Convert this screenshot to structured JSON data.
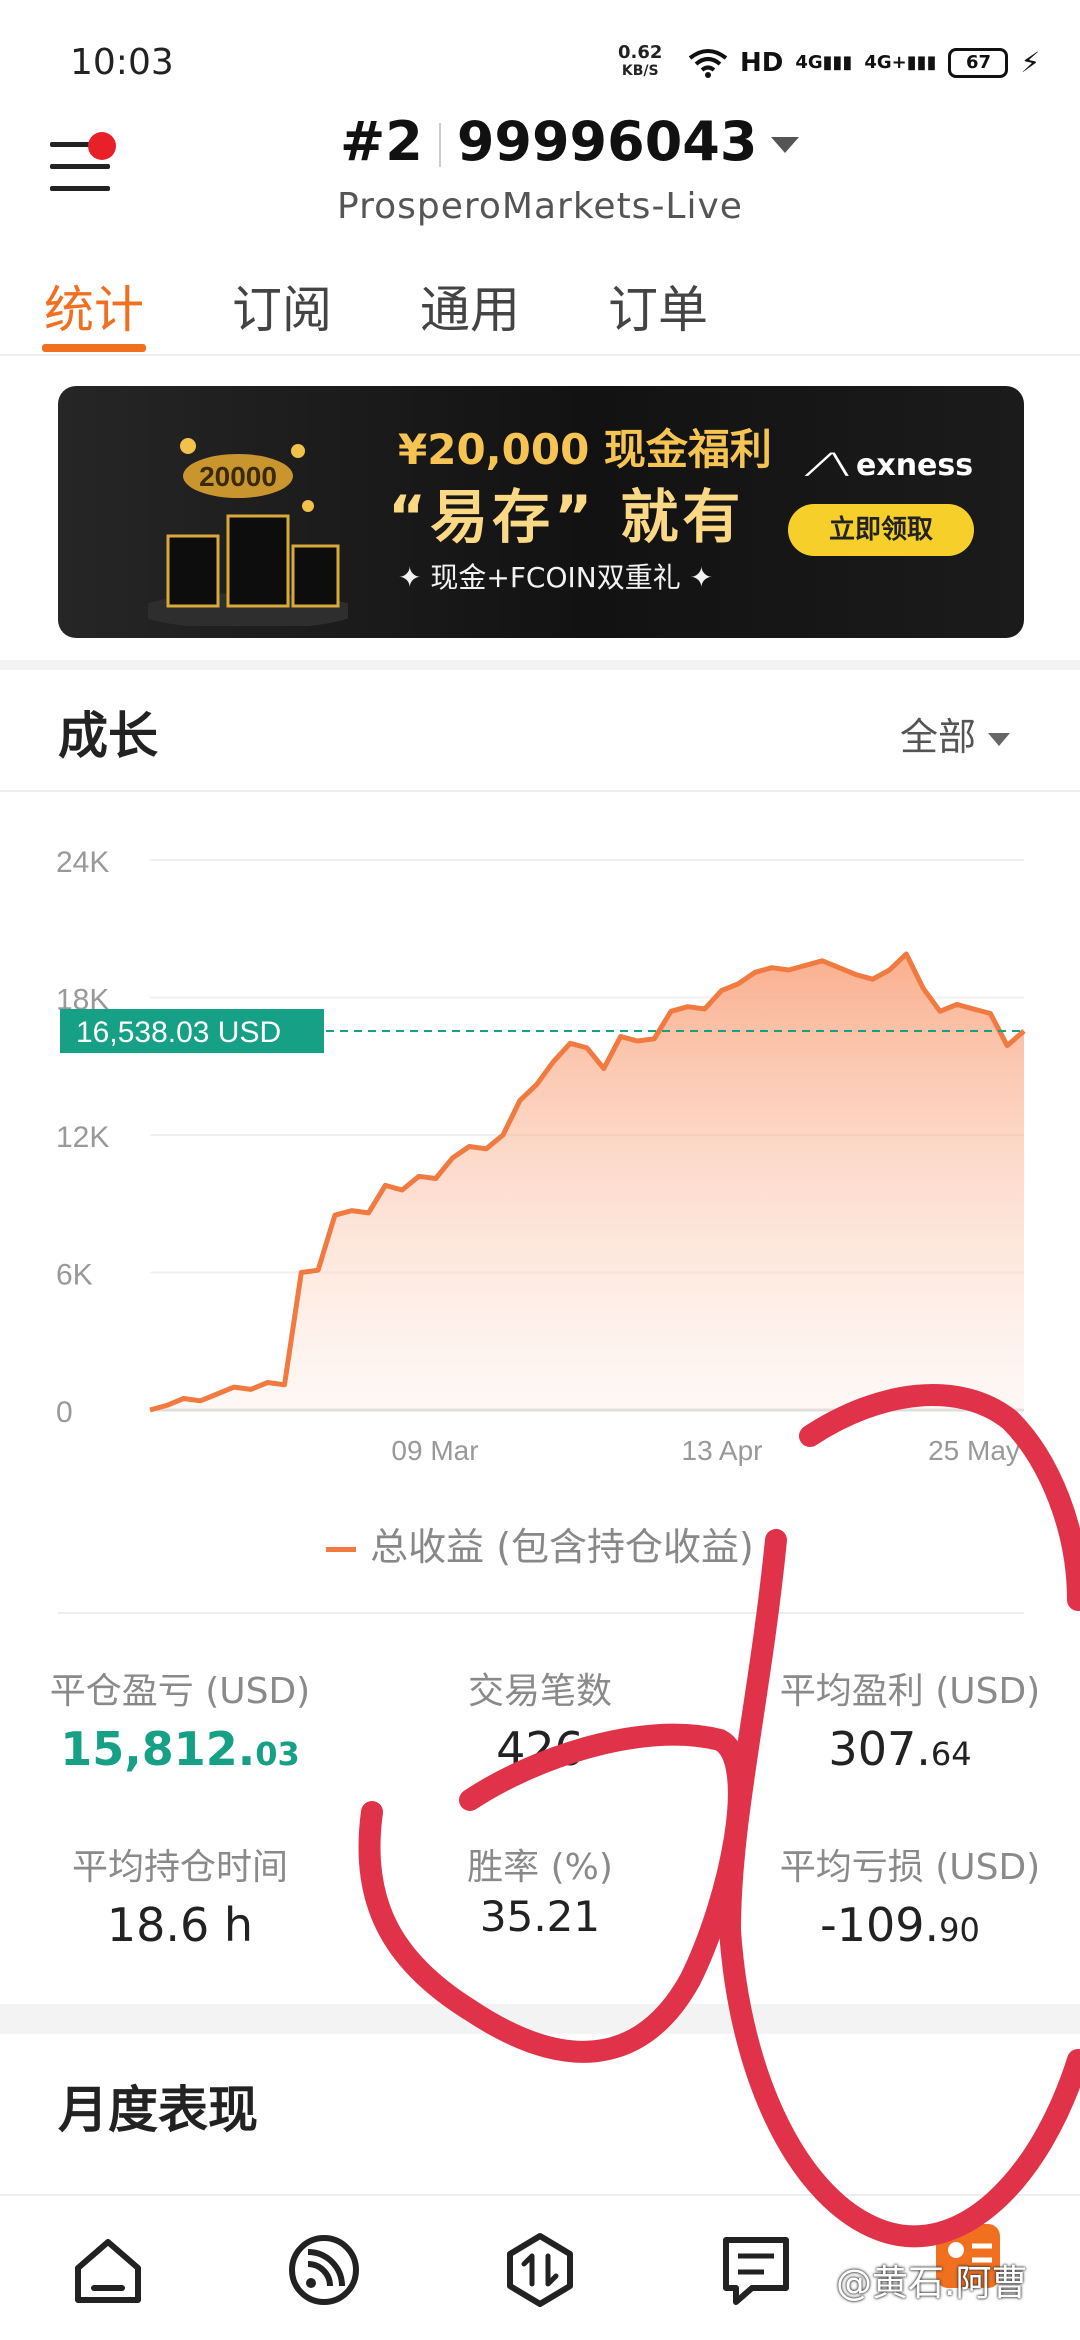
{
  "status_bar": {
    "time": "10:03",
    "net_speed": "0.62",
    "net_unit": "KB/S",
    "hd_label": "HD",
    "signal_1": "4G",
    "signal_2": "4G+",
    "battery": "67"
  },
  "header": {
    "account_number_prefix": "#2",
    "account_number": "99996043",
    "server": "ProsperoMarkets-Live"
  },
  "tabs": [
    {
      "label": "统计",
      "active": true
    },
    {
      "label": "订阅",
      "active": false
    },
    {
      "label": "通用",
      "active": false
    },
    {
      "label": "订单",
      "active": false
    }
  ],
  "banner": {
    "line1": "¥20,000 现金福利",
    "line2": "“易存” 就有",
    "line3": "✦  现金+FCOIN双重礼  ✦",
    "brand": "exness",
    "cta": "立即领取",
    "gift_label": "20000"
  },
  "growth": {
    "title": "成长",
    "filter": "全部",
    "legend": "总收益 (包含持仓收益)"
  },
  "chart_data": {
    "type": "area",
    "series": [
      {
        "name": "总收益 (包含持仓收益)",
        "color": "#f07a40"
      }
    ],
    "x_ticks": [
      "09 Mar",
      "13 Apr",
      "25 May"
    ],
    "y_ticks": [
      "0",
      "6K",
      "12K",
      "18K",
      "24K"
    ],
    "ylim": [
      0,
      24000
    ],
    "current_value_label": "16,538.03 USD",
    "current_value": 16538.03,
    "values": [
      0,
      200,
      500,
      400,
      700,
      1000,
      900,
      1200,
      1100,
      6000,
      6100,
      8500,
      8700,
      8600,
      9800,
      9600,
      10200,
      10100,
      11000,
      11500,
      11400,
      12000,
      13500,
      14200,
      15200,
      16000,
      15800,
      14900,
      16300,
      16100,
      16200,
      17400,
      17600,
      17500,
      18300,
      18600,
      19100,
      19300,
      19200,
      19400,
      19600,
      19300,
      19000,
      18800,
      19200,
      19900,
      18400,
      17400,
      17700,
      17500,
      17300,
      15900,
      16538.03
    ]
  },
  "stats": [
    {
      "label": "平仓盈亏 (USD)",
      "value_main": "15,812.",
      "value_small": "03"
    },
    {
      "label": "交易笔数",
      "value_main": "426",
      "value_small": ""
    },
    {
      "label": "平均盈利 (USD)",
      "value_main": "307.",
      "value_small": "64"
    },
    {
      "label": "平均持仓时间",
      "value_main": "18.6 h",
      "value_small": ""
    },
    {
      "label": "胜率 (%)",
      "value_main": "35.21",
      "value_small": ""
    },
    {
      "label": "平均亏损 (USD)",
      "value_main": "-109.",
      "value_small": "90"
    }
  ],
  "monthly": {
    "title": "月度表现"
  },
  "bottom_nav": [
    "home-icon",
    "subscription-icon",
    "trade-icon",
    "orders-icon",
    "profile-icon"
  ],
  "watermark": "@黄石.阿曹"
}
